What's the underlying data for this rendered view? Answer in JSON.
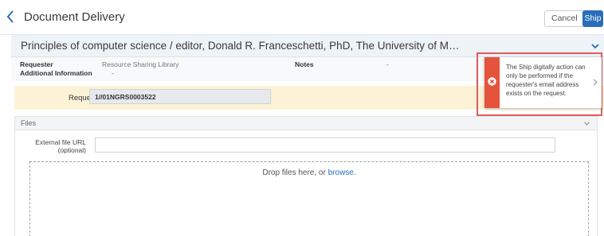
{
  "header": {
    "title": "Document Delivery",
    "cancel_label": "Cancel",
    "ship_label": "Ship"
  },
  "request": {
    "title": "Principles of computer science / editor, Donald R. Franceschetti, PhD, The University of M…",
    "requester_label": "Requester",
    "requester_value": "Resource Sharing Library",
    "additional_info_label": "Additional Information",
    "additional_info_value": "-",
    "notes_label": "Notes",
    "notes_value": "-",
    "request_id_label": "Request ID",
    "request_id_value": "1//01NGRS0003522"
  },
  "files": {
    "section_label": "Files",
    "url_label_line1": "External file URL",
    "url_label_line2": "(optional)",
    "url_value": "",
    "drop_text": "Drop files here, or ",
    "browse_label": "browse",
    "drop_suffix": "."
  },
  "toast": {
    "message": "The Ship digitally action can only be performed if the requester's email address exists on the request.",
    "status_color": "#e5533d"
  },
  "colors": {
    "accent": "#2a6ebb",
    "highlight_frame": "#e05c5c"
  }
}
